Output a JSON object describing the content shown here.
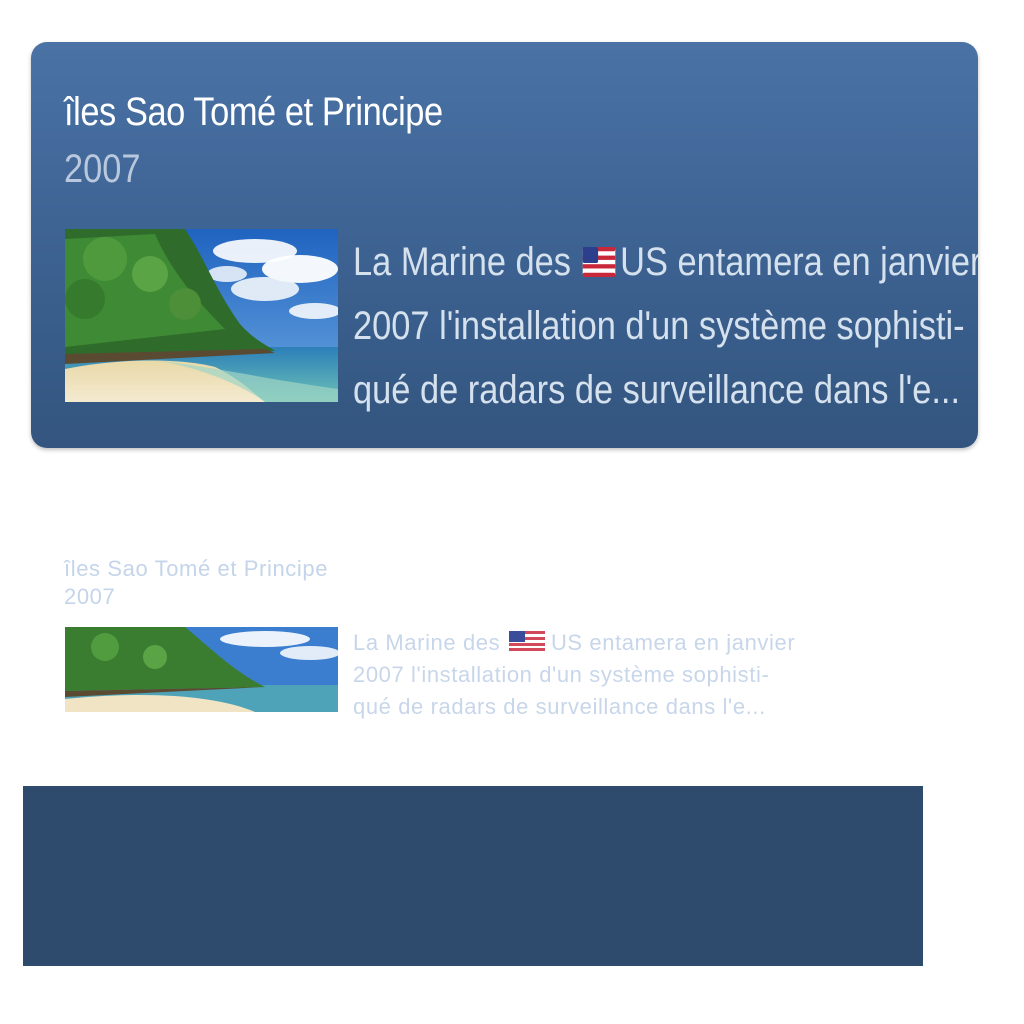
{
  "card": {
    "title": "îles Sao Tomé et Principe",
    "year": "2007",
    "body_lines": [
      "La Marine des",
      "US entamera en janvier",
      "2007 l'installation d'un système sophisti-",
      "qué de radars de surveillance dans l'e..."
    ],
    "flag_icon": "us-flag-icon",
    "thumbnail": "beach-thumbnail"
  },
  "reflection": {
    "title": "îles Sao Tomé et Principe",
    "year": "2007",
    "body_lines": [
      "La Marine des",
      "US entamera en janvier",
      "2007 l'installation d'un système sophisti-",
      "qué de radars de surveillance dans l'e..."
    ]
  },
  "colors": {
    "card_top": "#4a72a5",
    "card_bottom": "#33557f",
    "panel": "#2e4a6c"
  }
}
